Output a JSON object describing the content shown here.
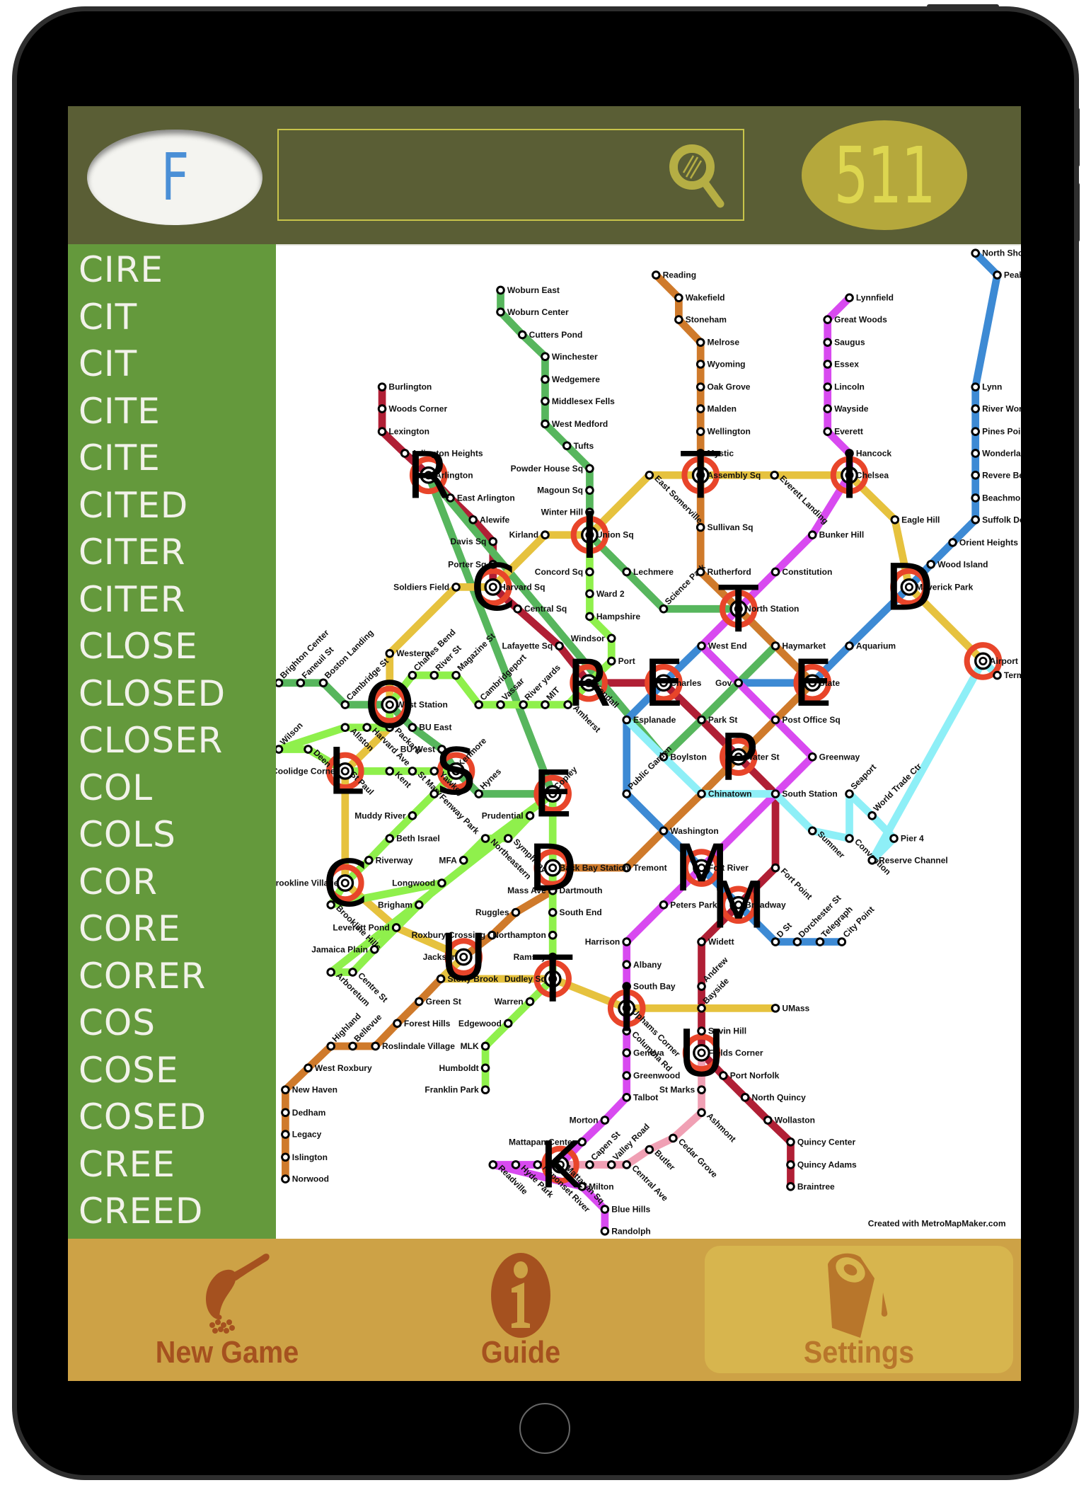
{
  "header": {
    "current_letter": "F",
    "search_placeholder": "",
    "search_value": "",
    "score": "511"
  },
  "sidebar": {
    "words": [
      "CIRE",
      "CIT",
      "CIT",
      "CITE",
      "CITE",
      "CITED",
      "CITER",
      "CITER",
      "CLOSE",
      "CLOSED",
      "CLOSER",
      "COL",
      "COLS",
      "COR",
      "CORE",
      "CORER",
      "COS",
      "COSE",
      "COSED",
      "CREE",
      "CREED"
    ]
  },
  "map": {
    "credit": "Created with MetroMapMaker.com",
    "colors": {
      "red": "#b01f35",
      "green": "#57b65d",
      "lightgreen": "#8ff04c",
      "orange": "#cf7a2b",
      "yellow": "#e6c23e",
      "blue": "#3d8ad4",
      "purple": "#d84af0",
      "cyan": "#8eeff7",
      "pink": "#f0a0b4",
      "darkgreen": "#4caa58",
      "hub": "#e8452a"
    },
    "lines": [
      {
        "name": "red-line",
        "color": "red",
        "stations": [
          "Burlington",
          "Woods Corner",
          "Lexington",
          "Arlington Heights",
          "Arlington",
          "East Arlington",
          "Alewife",
          "Davis Sq",
          "Porter Sq",
          "Harvard Sq",
          "Central Sq",
          "Lafayette Sq",
          "Kendall",
          "Charles",
          "Park St",
          "Water St",
          "South Station",
          "Fort Point",
          "Broadway",
          "Widett",
          "Andrew",
          "Bayside",
          "Savin Hill",
          "Fields Corner",
          "Port Norfolk",
          "North Quincy",
          "Wollaston",
          "Quincy Center",
          "Quincy Adams",
          "Braintree"
        ]
      },
      {
        "name": "green-line",
        "color": "green",
        "stations": [
          "Woburn East",
          "Woburn Center",
          "Cutters Pond",
          "Winchester",
          "Wedgemere",
          "Middlesex Fells",
          "West Medford",
          "Tufts",
          "Powder House Sq",
          "Magoun Sq",
          "Winter Hill",
          "Union Sq",
          "Lechmere",
          "Science Park",
          "North Station",
          "Haymarket",
          "Gov",
          "Park St",
          "Boylston",
          "Arlington",
          "Copley",
          "Hynes",
          "Kenmore",
          "BU West",
          "BU East",
          "West Station",
          "Cambridge St",
          "Boston Landing",
          "Faneuil St",
          "Brighton Center"
        ]
      },
      {
        "name": "orange-line",
        "color": "orange",
        "stations": [
          "Reading",
          "Wakefield",
          "Stoneham",
          "Melrose",
          "Wyoming",
          "Oak Grove",
          "Malden",
          "Wellington",
          "Mystic",
          "Assembly Sq",
          "Sullivan Sq",
          "Rutherford",
          "North Station",
          "Haymarket",
          "State",
          "Post Office Sq",
          "Water St",
          "Chinatown",
          "Washington",
          "Tremont",
          "Back Bay Station",
          "Mass Ave",
          "Ruggles",
          "Roxbury Crossing",
          "Jackson",
          "Stony Brook",
          "Green St",
          "Forest Hills",
          "Roslindale Village",
          "Bellevue",
          "Highland",
          "West Roxbury",
          "New Haven",
          "Dedham",
          "Legacy",
          "Islington",
          "Norwood"
        ]
      },
      {
        "name": "yellow-line",
        "color": "yellow",
        "stations": [
          "Airport",
          "Maverick Park",
          "Eagle Hill",
          "Chelsea",
          "Everett Landing",
          "Assembly Sq",
          "East Somerville",
          "Union Sq",
          "Kirland",
          "Harvard Sq",
          "Soldiers Field",
          "Western",
          "West Station",
          "Packard",
          "St Paul",
          "Brookline Village",
          "Leverett Pond",
          "Jackson",
          "Stony Brook",
          "Dudley Sq",
          "Uphams Corner",
          "Bayside",
          "UMass"
        ]
      },
      {
        "name": "blue-line",
        "color": "blue",
        "stations": [
          "North Shore",
          "Peabody",
          "Lynn",
          "River Works",
          "Pines Point",
          "Wonderland",
          "Revere Beach",
          "Beachmont",
          "Suffolk Downs",
          "Orient Heights",
          "Wood Island",
          "Maverick Park",
          "Aquarium",
          "State",
          "Gov",
          "West End",
          "Charles",
          "Esplanade",
          "Public Garden",
          "Washington",
          "Fort River",
          "Broadway",
          "D St",
          "Dorchester St",
          "Telegraph",
          "City Point"
        ]
      },
      {
        "name": "purple-line",
        "color": "purple",
        "stations": [
          "Lynnfield",
          "Great Woods",
          "Saugus",
          "Essex",
          "Lincoln",
          "Wayside",
          "Everett",
          "Hancock",
          "Chelsea",
          "Bunker Hill",
          "Constitution",
          "North Station",
          "West End",
          "Gov",
          "Post Office Sq",
          "Greenway",
          "South Station",
          "Fort River",
          "Peters Park",
          "Harrison",
          "Albany",
          "South Bay",
          "Uphams Corner",
          "Columbia Rd",
          "Geneva",
          "Greenwood",
          "Talbot",
          "Morton",
          "Mattapan Center",
          "Mattapan Sq",
          "Neponset River",
          "Hyde Park",
          "Readville",
          "Milton",
          "Blue Hills",
          "Randolph"
        ]
      },
      {
        "name": "lightgreen-line",
        "color": "lightgreen",
        "stations": [
          "Union Sq",
          "Concord Sq",
          "Ward 2",
          "Hampshire",
          "Windsor",
          "Port",
          "Kendall",
          "Amherst",
          "MIT",
          "River yards",
          "Vassar",
          "Cambridgeport",
          "Magazine St",
          "River St",
          "Charles Bend",
          "West Station",
          "Packard",
          "Harvard Ave",
          "Allston",
          "Wilson",
          "Deen",
          "Coolidge Corner",
          "St Paul",
          "Kent",
          "St Mary",
          "Yawkey",
          "Kenmore",
          "Fenway Park",
          "Muddy River",
          "Beth Israel",
          "Riverway",
          "Brookline Village",
          "Brookline Hills",
          "Longwood",
          "Brigham",
          "Jamaica Plain",
          "Centre St",
          "Arboretum",
          "Prudential",
          "Symphony",
          "Northeastern",
          "MFA",
          "Copley",
          "Dartmouth",
          "South End",
          "Northampton",
          "Ramsay",
          "Dudley Sq",
          "Warren",
          "Edgewood",
          "MLK",
          "Humboldt",
          "Franklin Park"
        ]
      },
      {
        "name": "cyan-line",
        "color": "cyan",
        "stations": [
          "Esplanade",
          "Boylston",
          "Chinatown",
          "South Station",
          "Summer",
          "Convention",
          "Seaport",
          "World Trade Ctr",
          "Pier 4",
          "Reserve Channel",
          "Airport",
          "Terminal"
        ]
      },
      {
        "name": "pink-line",
        "color": "pink",
        "stations": [
          "Fields Corner",
          "St Marks",
          "Ashmont",
          "Cedar Grove",
          "Butler",
          "Central Ave",
          "Valley Road",
          "Capen St",
          "Mattapan Sq"
        ]
      }
    ],
    "letters": [
      {
        "char": "C",
        "station": "Harvard Sq"
      },
      {
        "char": "I",
        "station": "Union Sq"
      },
      {
        "char": "T",
        "station": "Assembly Sq"
      },
      {
        "char": "I",
        "station": "Chelsea"
      },
      {
        "char": "D",
        "station": "Maverick Park"
      },
      {
        "char": "T",
        "station": "North Station"
      },
      {
        "char": "R",
        "station": "Kendall"
      },
      {
        "char": "E",
        "station": "Charles"
      },
      {
        "char": "E",
        "station": "State"
      },
      {
        "char": "O",
        "station": "West Station"
      },
      {
        "char": "L",
        "station": "Coolidge Corner"
      },
      {
        "char": "S",
        "station": "Kenmore"
      },
      {
        "char": "E",
        "station": "Copley"
      },
      {
        "char": "R",
        "station": "Arlington"
      },
      {
        "char": "P",
        "station": "Water St"
      },
      {
        "char": "C",
        "station": "Brookline Village"
      },
      {
        "char": "D",
        "station": "Back Bay Station"
      },
      {
        "char": "M",
        "station": "Fort River"
      },
      {
        "char": "M",
        "station": "Broadway"
      },
      {
        "char": "U",
        "station": "Jackson"
      },
      {
        "char": "T",
        "station": "Dudley Sq"
      },
      {
        "char": "I",
        "station": "Uphams Corner"
      },
      {
        "char": "U",
        "station": "Fields Corner"
      },
      {
        "char": "K",
        "station": "Mattapan Sq"
      }
    ],
    "hubs": [
      "Harvard Sq",
      "Union Sq",
      "Assembly Sq",
      "Chelsea",
      "Maverick Park",
      "North Station",
      "Kendall",
      "Charles",
      "State",
      "West Station",
      "Coolidge Corner",
      "Kenmore",
      "Copley",
      "Arlington",
      "Water St",
      "Brookline Village",
      "Back Bay Station",
      "Fort River",
      "Broadway",
      "Jackson",
      "Dudley Sq",
      "Uphams Corner",
      "Fields Corner",
      "Mattapan Sq",
      "Airport"
    ]
  },
  "toolbar": {
    "items": [
      {
        "label": "New Game",
        "icon": "scoop-icon"
      },
      {
        "label": "Guide",
        "icon": "info-icon"
      },
      {
        "label": "Settings",
        "icon": "cup-icon"
      }
    ],
    "text_color": "#a5511f",
    "active_index": 2
  }
}
